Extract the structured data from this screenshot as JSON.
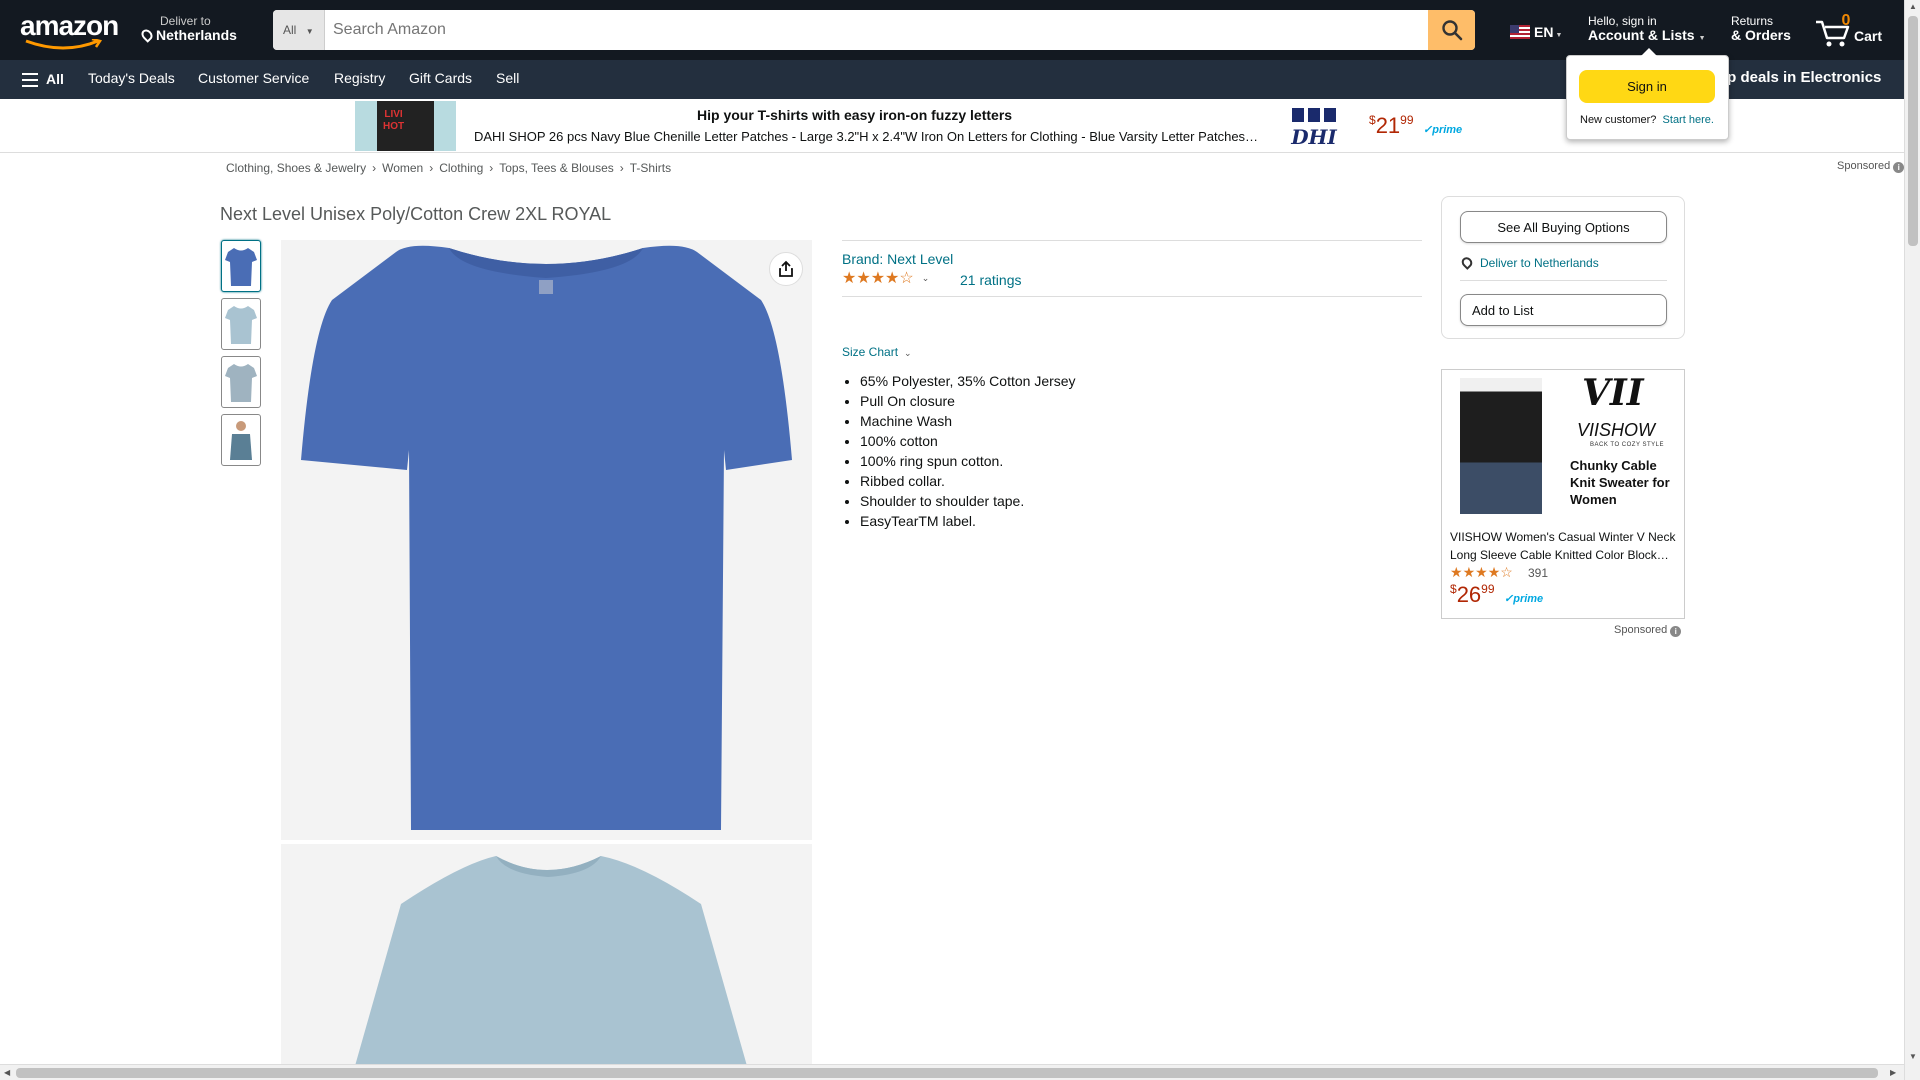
{
  "header": {
    "logo_text": "amazon",
    "deliver_line1": "Deliver to",
    "deliver_line2": "Netherlands",
    "search_category": "All",
    "search_placeholder": "Search Amazon",
    "lang": "EN",
    "account_line1": "Hello, sign in",
    "account_line2": "Account & Lists",
    "returns_line1": "Returns",
    "returns_line2": "& Orders",
    "cart_count": "0",
    "cart_label": "Cart"
  },
  "nav": {
    "all_label": "All",
    "items": [
      "Today's Deals",
      "Customer Service",
      "Registry",
      "Gift Cards",
      "Sell"
    ],
    "deals_promo": "op deals in Electronics"
  },
  "signin_popover": {
    "button_label": "Sign in",
    "new_customer": "New customer?",
    "start_here": "Start here."
  },
  "banner": {
    "image_text": "LIVI\nHOT",
    "title": "Hip your T-shirts with easy iron-on fuzzy letters",
    "description": "DAHI SHOP 26 pcs Navy Blue Chenille Letter Patches - Large 3.2\"H x 2.4\"W Iron On Letters for Clothing - Blue Varsity Letter Patches for Clothing, Hats, Jackets",
    "logo_text": "DHI",
    "price_symbol": "$",
    "price_whole": "21",
    "price_fraction": "99",
    "prime": "prime",
    "sponsored": "Sponsored"
  },
  "breadcrumb": [
    "Clothing, Shoes & Jewelry",
    "Women",
    "Clothing",
    "Tops, Tees & Blouses",
    "T-Shirts"
  ],
  "product": {
    "title": "Next Level Unisex Poly/Cotton Crew 2XL ROYAL",
    "brand": "Brand: Next Level",
    "rating": 4.0,
    "ratings_count": "21 ratings",
    "size_chart": "Size Chart",
    "bullets": [
      "65% Polyester, 35% Cotton Jersey",
      "Pull On closure",
      "Machine Wash",
      "100% cotton",
      "100% ring spun cotton.",
      "Ribbed collar.",
      "Shoulder to shoulder tape.",
      "EasyTearTM label."
    ]
  },
  "buybox": {
    "see_all": "See All Buying Options",
    "deliver": "Deliver to Netherlands",
    "add_to_list": "Add to List"
  },
  "ad": {
    "brand_big": "VII",
    "brand": "VIISHOW",
    "tagline": "BACK TO COZY STYLE",
    "headline": "Chunky Cable Knit Sweater for Women",
    "description": "VIISHOW Women's Casual Winter V Neck Long Sleeve Cable Knitted Color Block Sweater",
    "rating": 4.0,
    "rating_count": "391",
    "price_symbol": "$",
    "price_whole": "26",
    "price_fraction": "99",
    "prime": "prime",
    "sponsored": "Sponsored"
  },
  "colors": {
    "header_bg": "#131921",
    "nav_bg": "#232f3e",
    "search_button": "#febd69",
    "signin_button": "#ffd814",
    "link": "#007185",
    "star": "#de7921",
    "price": "#b12704",
    "shirt_royal": "#4a6db5",
    "shirt_light": "#a9c3d1"
  }
}
